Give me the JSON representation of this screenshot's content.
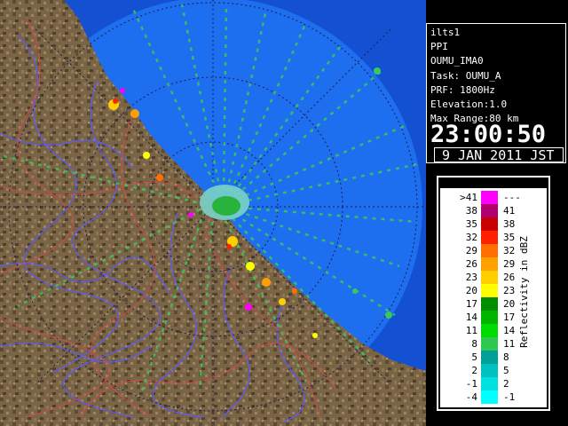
{
  "radar": {
    "station": "ilts1",
    "product": "PPI",
    "site": "OUMU_IMA0",
    "task": "Task: OUMU_A",
    "prf": "PRF: 1800Hz",
    "elevation": "Elevation:1.0",
    "max_range": "Max Range:80 km",
    "time": "23:00:50",
    "date": "9 JAN 2011 JST"
  },
  "legend": {
    "title": "Reflectivity in dBZ",
    "rows": [
      {
        "low": ">41",
        "high": "---",
        "color": "#ff00ff"
      },
      {
        "low": "38",
        "high": "41",
        "color": "#b0006e"
      },
      {
        "low": "35",
        "high": "38",
        "color": "#c80000"
      },
      {
        "low": "32",
        "high": "35",
        "color": "#ff2000"
      },
      {
        "low": "29",
        "high": "32",
        "color": "#ff7000"
      },
      {
        "low": "26",
        "high": "29",
        "color": "#ffa000"
      },
      {
        "low": "23",
        "high": "26",
        "color": "#ffd000"
      },
      {
        "low": "20",
        "high": "23",
        "color": "#ffff00"
      },
      {
        "low": "17",
        "high": "20",
        "color": "#008c00"
      },
      {
        "low": "14",
        "high": "17",
        "color": "#00b400"
      },
      {
        "low": "11",
        "high": "14",
        "color": "#00dc00"
      },
      {
        "low": "8",
        "high": "11",
        "color": "#30c850"
      },
      {
        "low": "5",
        "high": "8",
        "color": "#00a098"
      },
      {
        "low": "2",
        "high": "5",
        "color": "#00c0c0"
      },
      {
        "low": "-1",
        "high": "2",
        "color": "#00e0e0"
      },
      {
        "low": "-4",
        "high": "-1",
        "color": "#00ffff"
      }
    ]
  },
  "colors": {
    "sea": "#1e6ef0",
    "sea_outside": "#1450d2",
    "land": "#7a6446",
    "rivers": "#5a5aff",
    "borders": "#d24a4a"
  }
}
